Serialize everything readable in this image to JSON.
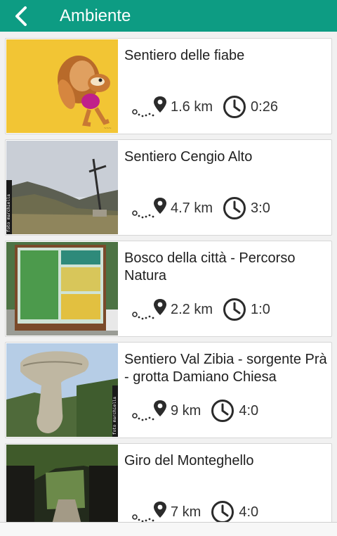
{
  "header": {
    "title": "Ambiente"
  },
  "trails": [
    {
      "name": "Sentiero delle fiabe",
      "distance": "1.6 km",
      "time": "0:26",
      "image": "cartoon-squirrel"
    },
    {
      "name": "Sentiero Cengio Alto",
      "distance": "4.7 km",
      "time": "3:0",
      "image": "mountain-cross",
      "watermark": "foto marchiella"
    },
    {
      "name": "Bosco della città - Percorso Natura",
      "distance": "2.2 km",
      "time": "1:0",
      "image": "nature-signboard"
    },
    {
      "name": "Sentiero Val Zibia - sorgente Prà - grotta Damiano Chiesa",
      "distance": "9 km",
      "time": "4:0",
      "image": "rock-formation",
      "watermark": "foto marchiella"
    },
    {
      "name": "Giro del Monteghello",
      "distance": "7 km",
      "time": "4:0",
      "image": "forest-path"
    }
  ],
  "colors": {
    "appbar": "#0d9c83",
    "icon": "#2b2b2b"
  }
}
